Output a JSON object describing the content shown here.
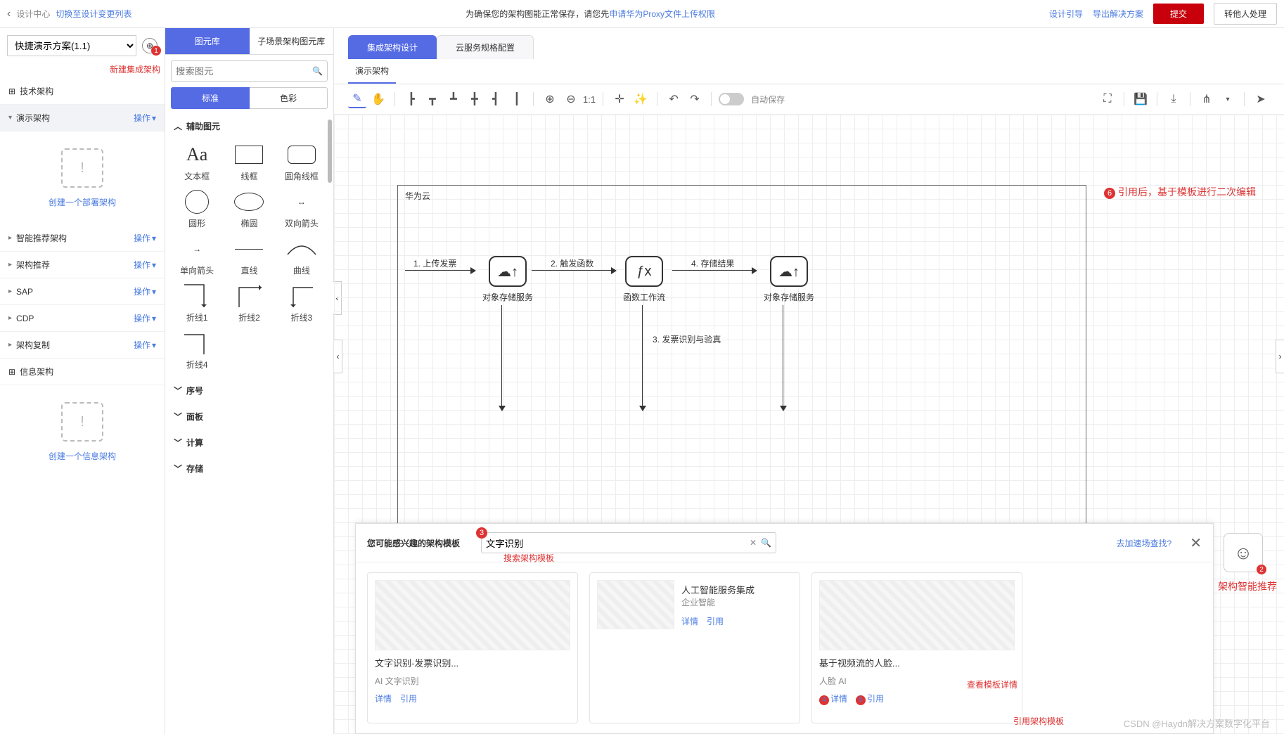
{
  "topbar": {
    "back_icon": "‹",
    "design_center": "设计中心",
    "switch_list": "切换至设计变更列表",
    "notice_prefix": "为确保您的架构图能正常保存，请您先",
    "notice_link": "申请华为Proxy文件上传权限",
    "guide": "设计引导",
    "export": "导出解决方案",
    "submit": "提交",
    "transfer": "转他人处理"
  },
  "project": {
    "selected": "快捷演示方案(1.1)",
    "globe_badge": "1",
    "anno1": "新建集成架构"
  },
  "leftnav": {
    "tech_arch": "技术架构",
    "demo_arch": "演示架构",
    "ops": "操作",
    "create_deploy": "创建一个部署架构",
    "items": [
      {
        "label": "智能推荐架构"
      },
      {
        "label": "架构推荐"
      },
      {
        "label": "SAP"
      },
      {
        "label": "CDP"
      },
      {
        "label": "架构复制"
      }
    ],
    "info_arch": "信息架构",
    "create_info": "创建一个信息架构"
  },
  "palette": {
    "tab_lib": "图元库",
    "tab_sub": "子场景架构图元库",
    "search_placeholder": "搜索图元",
    "mode_std": "标准",
    "mode_color": "色彩",
    "cat_aux": "辅助图元",
    "shapes": [
      {
        "name": "文本框"
      },
      {
        "name": "线框"
      },
      {
        "name": "圆角线框"
      },
      {
        "name": "圆形"
      },
      {
        "name": "椭圆"
      },
      {
        "name": "双向箭头"
      },
      {
        "name": "单向箭头"
      },
      {
        "name": "直线"
      },
      {
        "name": "曲线"
      },
      {
        "name": "折线1"
      },
      {
        "name": "折线2"
      },
      {
        "name": "折线3"
      },
      {
        "name": "折线4"
      }
    ],
    "cats": [
      {
        "label": "序号"
      },
      {
        "label": "面板"
      },
      {
        "label": "计算"
      },
      {
        "label": "存储"
      }
    ]
  },
  "design": {
    "tab1": "集成架构设计",
    "tab2": "云服务规格配置",
    "subtab": "演示架构",
    "autosave": "自动保存",
    "ratio": "1:1"
  },
  "canvas": {
    "frame_title": "华为云",
    "step1": "1. 上传发票",
    "step2": "2. 触发函数",
    "step3": "3. 发票识别与验真",
    "step4": "4. 存储结果",
    "node_obs": "对象存储服务",
    "node_fn": "函数工作流",
    "anno6": "引用后，基于模板进行二次编辑"
  },
  "templates": {
    "title": "您可能感兴趣的架构模板",
    "search_value": "文字识别",
    "search_anno": "搜索架构模板",
    "go_market": "去加速场查找?",
    "detail": "详情",
    "quote": "引用",
    "cards": [
      {
        "name": "文字识别-发票识别...",
        "tags": "AI  文字识别"
      },
      {
        "name": "人工智能服务集成",
        "tags": "企业智能"
      },
      {
        "name": "基于视频流的人脸...",
        "tags": "人脸  AI"
      }
    ],
    "anno_view": "查看模板详情",
    "anno_quote": "引用架构模板"
  },
  "float": {
    "label": "架构智能推荐",
    "badge": "2"
  },
  "watermark": "CSDN @Haydn解决方案数字化平台"
}
